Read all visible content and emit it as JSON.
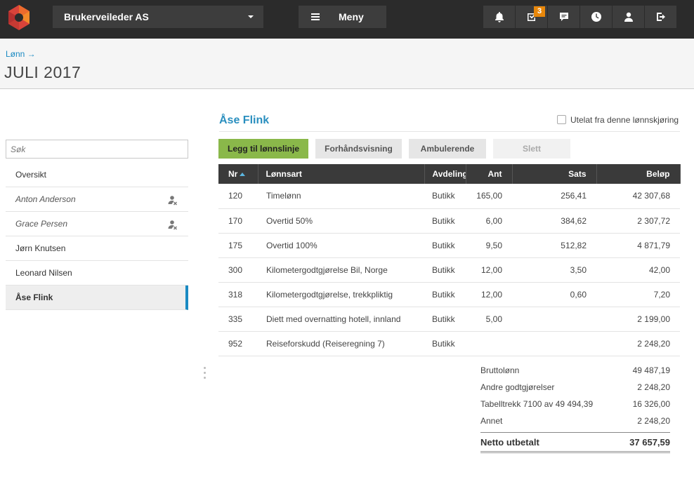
{
  "topbar": {
    "company": "Brukerveileder AS",
    "menu_label": "Meny",
    "tasks_badge": "3",
    "icons": [
      "bell-icon",
      "tasks-icon",
      "chat-icon",
      "clock-icon",
      "user-icon",
      "logout-icon"
    ]
  },
  "breadcrumb": "Lønn →",
  "page_title": "JULI 2017",
  "sidebar": {
    "search_placeholder": "Søk",
    "items": [
      {
        "label": "Oversikt"
      },
      {
        "label": "Anton Anderson"
      },
      {
        "label": "Grace Persen"
      },
      {
        "label": "Jørn Knutsen"
      },
      {
        "label": "Leonard Nilsen"
      },
      {
        "label": "Åse Flink"
      }
    ]
  },
  "employee": {
    "name": "Åse Flink",
    "exclude_label": "Utelat fra denne lønnskjøring"
  },
  "actions": {
    "add": "Legg til lønnslinje",
    "preview": "Forhåndsvisning",
    "ambulant": "Ambulerende",
    "delete": "Slett"
  },
  "table": {
    "headers": {
      "nr": "Nr",
      "art": "Lønnsart",
      "avd": "Avdeling",
      "ant": "Ant",
      "sats": "Sats",
      "belop": "Beløp"
    },
    "rows": [
      {
        "nr": "120",
        "art": "Timelønn",
        "avd": "Butikk",
        "ant": "165,00",
        "sats": "256,41",
        "belop": "42 307,68"
      },
      {
        "nr": "170",
        "art": "Overtid 50%",
        "avd": "Butikk",
        "ant": "6,00",
        "sats": "384,62",
        "belop": "2 307,72"
      },
      {
        "nr": "175",
        "art": "Overtid 100%",
        "avd": "Butikk",
        "ant": "9,50",
        "sats": "512,82",
        "belop": "4 871,79"
      },
      {
        "nr": "300",
        "art": "Kilometergodtgjørelse Bil, Norge",
        "avd": "Butikk",
        "ant": "12,00",
        "sats": "3,50",
        "belop": "42,00"
      },
      {
        "nr": "318",
        "art": "Kilometergodtgjørelse, trekkpliktig",
        "avd": "Butikk",
        "ant": "12,00",
        "sats": "0,60",
        "belop": "7,20"
      },
      {
        "nr": "335",
        "art": "Diett med overnatting hotell, innland",
        "avd": "Butikk",
        "ant": "5,00",
        "sats": "",
        "belop": "2 199,00"
      },
      {
        "nr": "952",
        "art": "Reiseforskudd (Reiseregning 7)",
        "avd": "Butikk",
        "ant": "",
        "sats": "",
        "belop": "2 248,20"
      }
    ]
  },
  "summary": {
    "brutto_label": "Bruttolønn",
    "brutto_value": "49 487,19",
    "andre_label": "Andre godtgjørelser",
    "andre_value": "2 248,20",
    "trekk_label": "Tabelltrekk 7100 av 49 494,39",
    "trekk_value": "16 326,00",
    "annet_label": "Annet",
    "annet_value": "2 248,20",
    "netto_label": "Netto utbetalt",
    "netto_value": "37 657,59"
  }
}
